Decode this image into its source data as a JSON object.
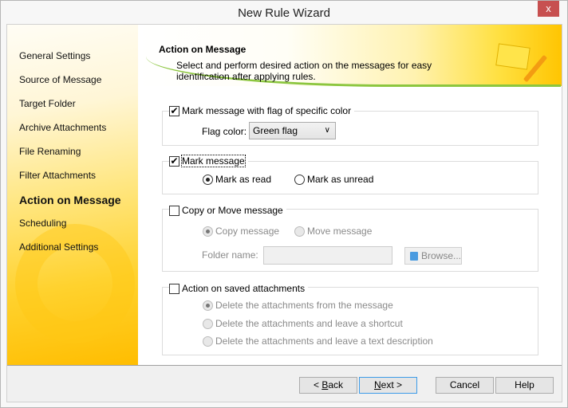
{
  "window": {
    "title": "New Rule Wizard",
    "close_label": "x"
  },
  "sidebar": {
    "items": [
      {
        "label": "General Settings",
        "active": false
      },
      {
        "label": "Source of Message",
        "active": false
      },
      {
        "label": "Target Folder",
        "active": false
      },
      {
        "label": "Archive Attachments",
        "active": false
      },
      {
        "label": "File Renaming",
        "active": false
      },
      {
        "label": "Filter Attachments",
        "active": false
      },
      {
        "label": "Action on Message",
        "active": true
      },
      {
        "label": "Scheduling",
        "active": false
      },
      {
        "label": "Additional Settings",
        "active": false
      }
    ]
  },
  "header": {
    "title": "Action on Message",
    "description": "Select and perform desired action on the messages for easy identification after applying rules."
  },
  "flag_group": {
    "label": "Mark message with flag of specific color",
    "checked": true,
    "flag_color_label": "Flag color:",
    "flag_color_value": "Green flag"
  },
  "mark_group": {
    "label": "Mark message",
    "checked": true,
    "options": [
      "Mark as read",
      "Mark as unread"
    ],
    "selected": "Mark as read"
  },
  "copy_group": {
    "label": "Copy or Move message",
    "checked": false,
    "options": [
      "Copy message",
      "Move message"
    ],
    "selected": "Copy message",
    "folder_label": "Folder name:",
    "folder_value": "",
    "browse_label": "Browse..."
  },
  "attach_group": {
    "label": "Action on saved attachments",
    "checked": false,
    "options": [
      "Delete the attachments from the message",
      "Delete the attachments and leave a shortcut",
      "Delete the attachments and leave a text description"
    ],
    "selected": "Delete the attachments from the message"
  },
  "footer": {
    "back_prefix": "< ",
    "back_key": "B",
    "back_rest": "ack",
    "next_key": "N",
    "next_rest": "ext >",
    "cancel": "Cancel",
    "help": "Help"
  },
  "colors": {
    "close": "#c75050",
    "accent_green": "#8cc63f",
    "sidebar_yellow": "#ffc400"
  }
}
